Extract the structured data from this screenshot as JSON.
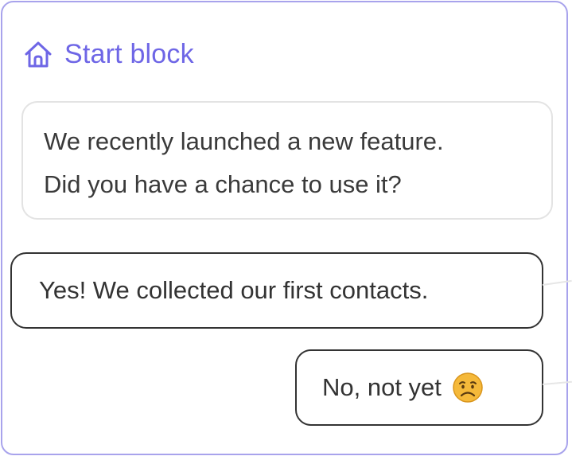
{
  "block": {
    "title": "Start block",
    "icon": "home-icon",
    "accent_color": "#6e66e6",
    "border_color": "#a8a3ec"
  },
  "message": {
    "lines": [
      "We recently launched a new feature.",
      "Did you have a chance to use it?"
    ]
  },
  "replies": [
    {
      "label": "Yes! We collected our first contacts."
    },
    {
      "label": "No, not yet",
      "emoji": "disappointed-face-icon"
    }
  ]
}
